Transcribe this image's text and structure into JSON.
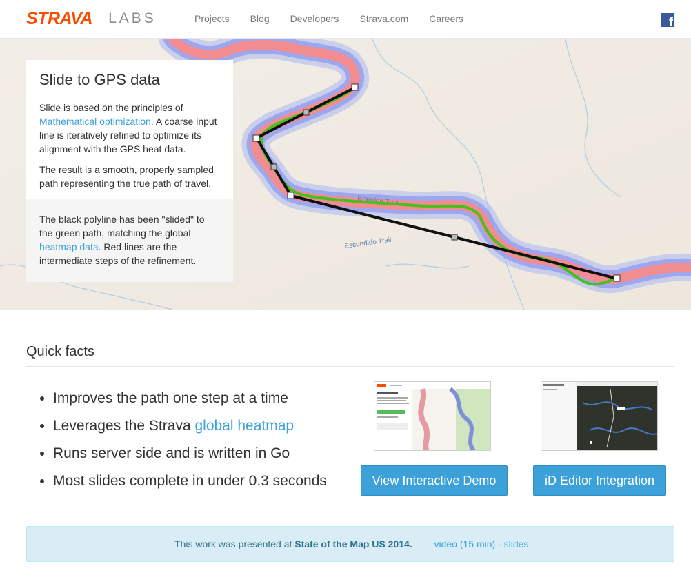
{
  "brand": {
    "name": "STRAVA",
    "sub": "LABS",
    "accent": "#fc4c02"
  },
  "nav": {
    "items": [
      "Projects",
      "Blog",
      "Developers",
      "Strava.com",
      "Careers"
    ]
  },
  "social": {
    "icon": "facebook-icon",
    "glyph": "f"
  },
  "hero": {
    "title": "Slide to GPS data",
    "p1_before": "Slide is based on the principles of ",
    "p1_link": "Mathematical optimization.",
    "p1_after": " A coarse input line is iteratively refined to optimize its alignment with the GPS heat data.",
    "p2": "The result is a smooth, properly sampled path representing the true path of travel.",
    "p3_before": "The black polyline has been \"slided\" to the green path, matching the global ",
    "p3_link": "heatmap data",
    "p3_after": ". Red lines are the intermediate steps of the refinement.",
    "map_labels": {
      "trail1": "Brandon Trail",
      "trail2": "Escondido Trail"
    }
  },
  "quick_facts": {
    "title": "Quick facts",
    "items": [
      {
        "text": "Improves the path one step at a time"
      },
      {
        "text": "Leverages the Strava ",
        "link": "global heatmap"
      },
      {
        "text": "Runs server side and is written in Go"
      },
      {
        "text": "Most slides complete in under 0.3 seconds"
      }
    ],
    "demo_button": "View Interactive Demo",
    "editor_button": "iD Editor Integration"
  },
  "notice": {
    "before": "This work was presented at ",
    "event": "State of the Map US 2014.",
    "video": "video (15 min)",
    "dash": "-",
    "slides": "slides"
  },
  "colors": {
    "link": "#3ca0d9",
    "button": "#3ca0d9",
    "path_green": "#44c21b",
    "heat_red": "#f58a8a",
    "heat_blue": "#8aa6f5"
  }
}
